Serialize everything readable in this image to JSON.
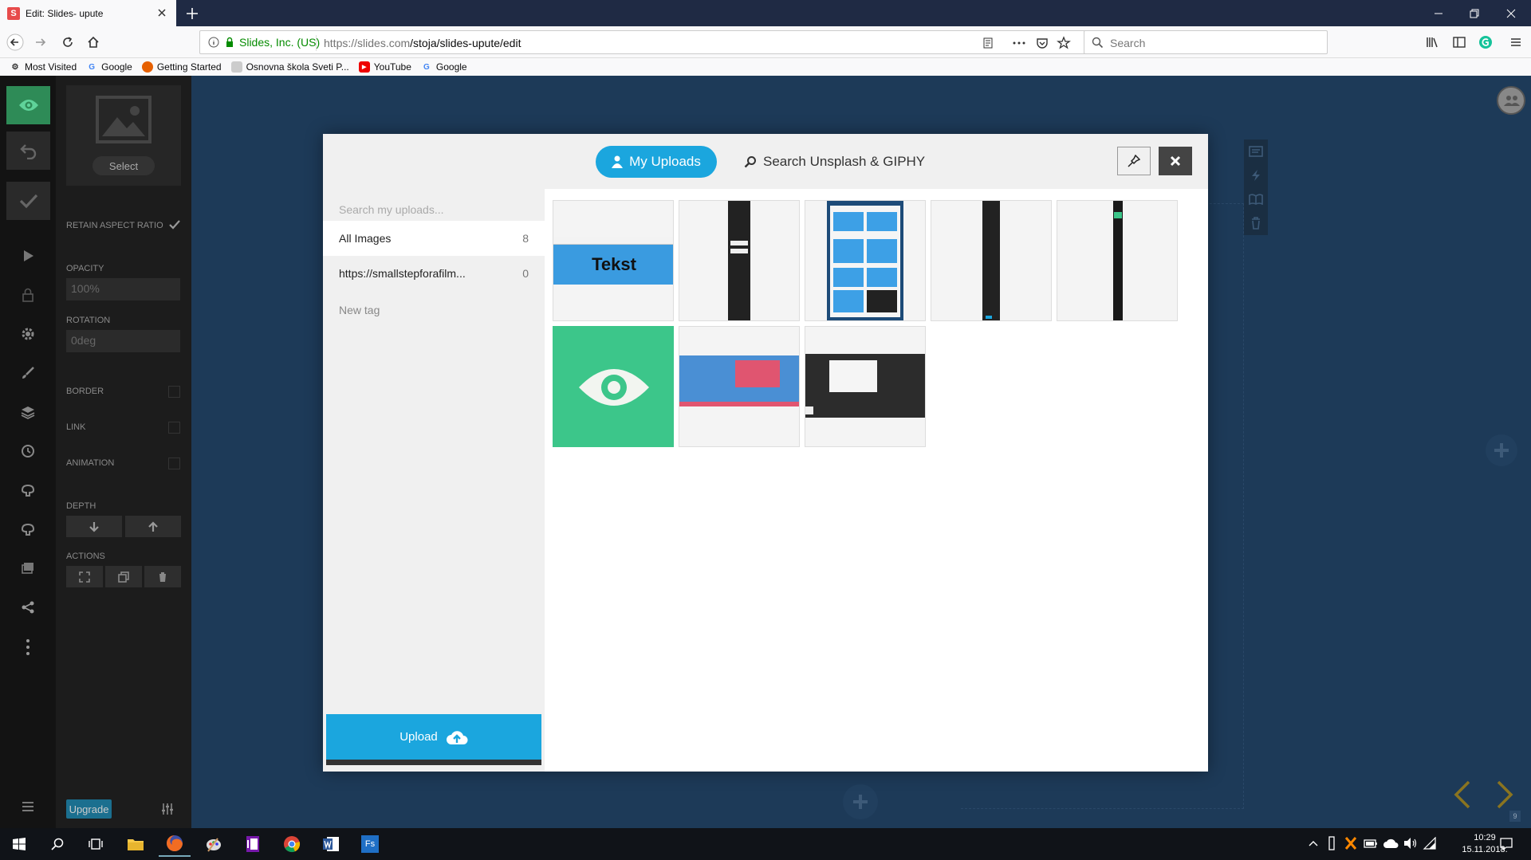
{
  "browser": {
    "tab_title": "Edit: Slides- upute",
    "tab_favicon": "S",
    "identity": "Slides, Inc. (US)",
    "url_host": "https://slides.com",
    "url_path": "/stoja/slides-upute/edit",
    "search_placeholder": "Search",
    "bookmarks": [
      {
        "label": "Most Visited",
        "icon": "gear-icon"
      },
      {
        "label": "Google",
        "icon": "google-icon"
      },
      {
        "label": "Getting Started",
        "icon": "firefox-icon"
      },
      {
        "label": "Osnovna škola Sveti P...",
        "icon": "school-icon"
      },
      {
        "label": "YouTube",
        "icon": "youtube-icon"
      },
      {
        "label": "Google",
        "icon": "google-icon"
      }
    ]
  },
  "editor": {
    "select_label": "Select",
    "retain_aspect_ratio": "RETAIN ASPECT RATIO",
    "opacity_label": "OPACITY",
    "opacity_value": "100%",
    "rotation_label": "ROTATION",
    "rotation_value": "0deg",
    "border_label": "BORDER",
    "link_label": "LINK",
    "animation_label": "ANIMATION",
    "depth_label": "DEPTH",
    "actions_label": "ACTIONS",
    "upgrade_label": "Upgrade",
    "slide_number": "9"
  },
  "modal": {
    "tab_uploads": "My Uploads",
    "tab_unsplash": "Search Unsplash & GIPHY",
    "search_placeholder": "Search my uploads...",
    "tags": [
      {
        "label": "All Images",
        "count": "8"
      },
      {
        "label": "https://smallstepforafilm...",
        "count": "0"
      }
    ],
    "new_tag": "New tag",
    "upload_label": "Upload",
    "thumb_text": "Tekst"
  },
  "taskbar": {
    "time": "10:29",
    "date": "15.11.2018."
  },
  "colors": {
    "accent": "#1ba6de",
    "canvas": "#1d3a58",
    "preview_green": "#2e8b57",
    "eye_green": "#3cc68a"
  }
}
